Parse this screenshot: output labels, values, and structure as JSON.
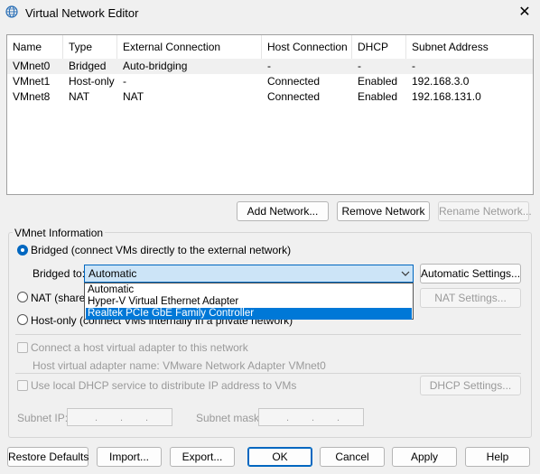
{
  "window": {
    "title": "Virtual Network Editor",
    "close": "✕"
  },
  "table": {
    "headers": [
      "Name",
      "Type",
      "External Connection",
      "Host Connection",
      "DHCP",
      "Subnet Address"
    ],
    "rows": [
      [
        "VMnet0",
        "Bridged",
        "Auto-bridging",
        "-",
        "-",
        "-"
      ],
      [
        "VMnet1",
        "Host-only",
        "-",
        "Connected",
        "Enabled",
        "192.168.3.0"
      ],
      [
        "VMnet8",
        "NAT",
        "NAT",
        "Connected",
        "Enabled",
        "192.168.131.0"
      ]
    ]
  },
  "table_buttons": {
    "add": "Add Network...",
    "remove": "Remove Network",
    "rename": "Rename Network..."
  },
  "vmnet_info": {
    "legend": "VMnet Information",
    "bridged_label": "Bridged (connect VMs directly to the external network)",
    "bridged_to_label": "Bridged to:",
    "bridged_to_value": "Automatic",
    "automatic_settings": "Automatic Settings...",
    "dropdown_options": [
      "Automatic",
      "Hyper-V Virtual Ethernet Adapter",
      "Realtek PCIe GbE Family Controller"
    ],
    "nat_label": "NAT (shared",
    "nat_settings": "NAT Settings...",
    "hostonly_label": "Host-only (connect VMs internally in a private network)",
    "connect_adapter": "Connect a host virtual adapter to this network",
    "adapter_name": "Host virtual adapter name: VMware Network Adapter VMnet0",
    "use_dhcp": "Use local DHCP service to distribute IP address to VMs",
    "dhcp_settings": "DHCP Settings...",
    "subnet_ip": "Subnet IP:",
    "subnet_mask": "Subnet mask:",
    "ip_placeholder": ". . ."
  },
  "bottom_buttons": {
    "restore": "Restore Defaults",
    "import": "Import...",
    "export": "Export...",
    "ok": "OK",
    "cancel": "Cancel",
    "apply": "Apply",
    "help": "Help"
  },
  "colors": {
    "accent": "#0067c0",
    "highlight": "#0078d7",
    "selection": "#cce4f7"
  },
  "icons": {
    "title": "globe-icon",
    "chevron": "chevron-down-icon"
  }
}
